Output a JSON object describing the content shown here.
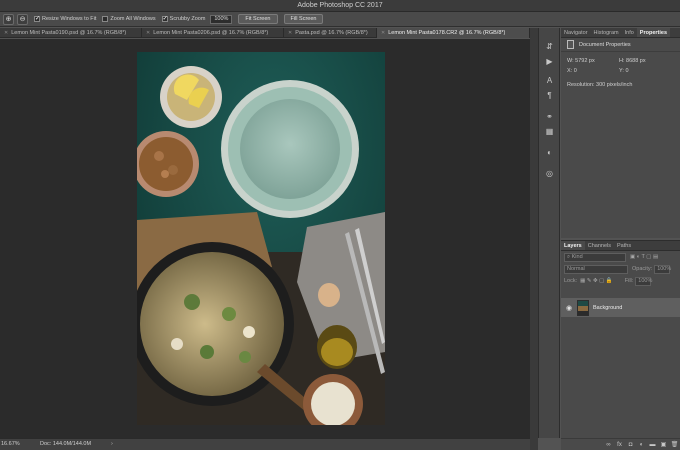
{
  "titlebar": {
    "title": "Adobe Photoshop CC 2017"
  },
  "options": {
    "zoom_in_icon": "zoom-in-icon",
    "zoom_out_icon": "zoom-out-icon",
    "resize_windows": {
      "label": "Resize Windows to Fit",
      "checked": true
    },
    "zoom_all_windows": {
      "label": "Zoom All Windows",
      "checked": false
    },
    "scrubby_zoom": {
      "label": "Scrubby Zoom",
      "checked": true
    },
    "zoom_value": "100%",
    "fit_screen_label": "Fit Screen",
    "fill_screen_label": "Fill Screen"
  },
  "tabs": [
    {
      "label": "Lemon Mint Pasta0190.psd @ 16.7% (RGB/8*)",
      "active": false
    },
    {
      "label": "Lemon Mint Pasta0206.psd @ 16.7% (RGB/8*)",
      "active": false
    },
    {
      "label": "Pasta.psd @ 16.7% (RGB/8*)",
      "active": false
    },
    {
      "label": "Lemon Mint Pasta0178.CR2 @ 16.7% (RGB/8*)",
      "active": true
    }
  ],
  "status": {
    "zoom": "16.67%",
    "doc": "Doc: 144.0M/144.0M",
    "arrow": "›"
  },
  "strip_icons": [
    "move-tool-icon",
    "play-icon",
    "character-icon",
    "paragraph-icon",
    "adjustments-icon",
    "swatches-grid-icon",
    "styles-icon",
    "layer-comps-icon"
  ],
  "properties": {
    "tabs": [
      {
        "label": "Navigator",
        "active": false
      },
      {
        "label": "Histogram",
        "active": false
      },
      {
        "label": "Info",
        "active": false
      },
      {
        "label": "Properties",
        "active": true
      }
    ],
    "header": "Document Properties",
    "w_label": "W:",
    "w_value": "5792 px",
    "h_label": "H:",
    "h_value": "8688 px",
    "x_label": "X:",
    "x_value": "0",
    "y_label": "Y:",
    "y_value": "0",
    "resolution": "Resolution: 300 pixels/inch"
  },
  "layers": {
    "tabs": [
      {
        "label": "Layers",
        "active": true
      },
      {
        "label": "Channels",
        "active": false
      },
      {
        "label": "Paths",
        "active": false
      }
    ],
    "kind_placeholder": "Kind",
    "blend_mode": "Normal",
    "opacity_label": "Opacity:",
    "opacity_value": "100%",
    "lock_label": "Lock:",
    "fill_label": "Fill:",
    "fill_value": "100%",
    "layer_name": "Background"
  }
}
